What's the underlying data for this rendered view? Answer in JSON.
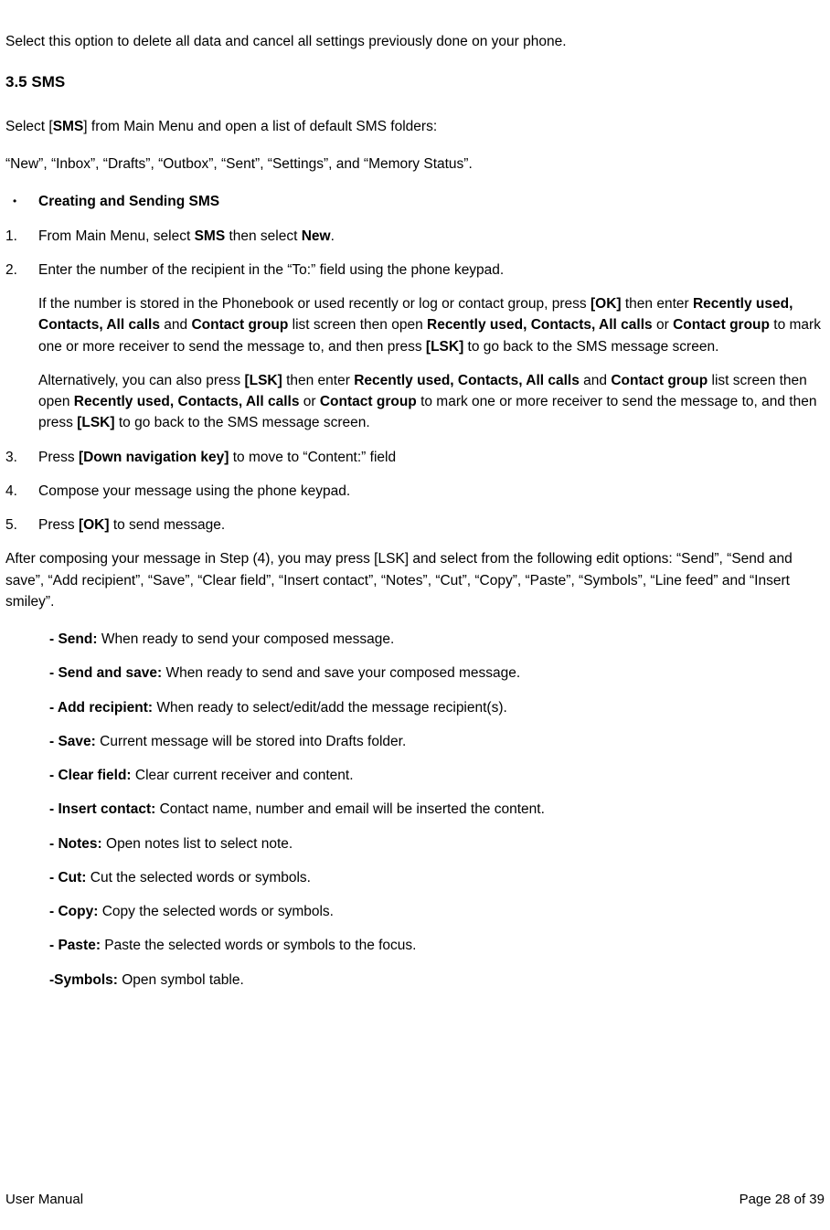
{
  "intro": "Select this option to delete all data and cancel all settings previously done on your phone.",
  "section_heading": "3.5 SMS",
  "p1_pre": "Select [",
  "p1_bold": "SMS",
  "p1_post": "] from Main Menu and open a list of default SMS folders:",
  "p2": "“New”, “Inbox”, “Drafts”, “Outbox”, “Sent”, “Settings”, and “Memory Status”.",
  "bullet_heading": "Creating and Sending SMS",
  "steps": {
    "s1": {
      "num": "1.",
      "t1": "From Main Menu, select ",
      "b1": "SMS",
      "t2": " then select ",
      "b2": "New",
      "t3": "."
    },
    "s2": {
      "num": "2.",
      "line1": "Enter the number of the recipient in the “To:” field using the phone keypad.",
      "p2_t1": "If the number is stored in the Phonebook or used recently or log or contact group, press ",
      "p2_b1": "[OK]",
      "p2_t2": " then enter ",
      "p2_b2": "Recently used, Contacts, All calls",
      "p2_t3": " and ",
      "p2_b3": "Contact group",
      "p2_t4": " list screen then open ",
      "p2_b4": "Recently used, Contacts, All calls",
      "p2_t5": " or ",
      "p2_b5": "Contact group",
      "p2_t6": " to mark one or more receiver to send the message to, and then press ",
      "p2_b6": "[LSK]",
      "p2_t7": " to go back to the SMS message screen.",
      "p3_t1": "Alternatively, you can also press ",
      "p3_b1": "[LSK]",
      "p3_t2": " then enter ",
      "p3_b2": "Recently used, Contacts, All calls",
      "p3_t3": " and ",
      "p3_b3": "Contact group",
      "p3_t4": " list screen then open ",
      "p3_b4": "Recently used, Contacts, All calls",
      "p3_t5": " or ",
      "p3_b5": "Contact group",
      "p3_t6": " to mark one or more receiver to send the message to, and then press ",
      "p3_b6": "[LSK]",
      "p3_t7": " to go back to the SMS message screen."
    },
    "s3": {
      "num": "3.",
      "t1": "Press ",
      "b1": "[Down navigation key]",
      "t2": " to move to “Content:” field"
    },
    "s4": {
      "num": "4.",
      "t1": "Compose your message using the phone keypad."
    },
    "s5": {
      "num": "5.",
      "t1": "Press ",
      "b1": "[OK]",
      "t2": " to send message."
    }
  },
  "after": "After composing your message in Step (4), you may press [LSK] and select from the following edit options: “Send”, “Send and save”, “Add recipient”, “Save”, “Clear field”, “Insert contact”, “Notes”, “Cut”, “Copy”, “Paste”, “Symbols”, “Line feed” and “Insert smiley”.",
  "opts": [
    {
      "b": "- Send:",
      "t": " When ready to send your composed message."
    },
    {
      "b": "- Send and save:",
      "t": " When ready to send and save your composed message."
    },
    {
      "b": "- Add recipient:",
      "t": " When ready to select/edit/add the message recipient(s)."
    },
    {
      "b": "- Save:",
      "t": " Current message will be stored into Drafts folder."
    },
    {
      "b": "- Clear field:",
      "t": " Clear current receiver and content."
    },
    {
      "b": "- Insert contact:",
      "t": " Contact name, number and email will be inserted the content."
    },
    {
      "b": "- Notes:",
      "t": " Open notes list to select note."
    },
    {
      "b": "- Cut:",
      "t": " Cut the selected words or symbols."
    },
    {
      "b": "- Copy:",
      "t": " Copy the selected words or symbols."
    },
    {
      "b": "- Paste:",
      "t": " Paste the selected words or symbols to the focus."
    },
    {
      "b": "-Symbols:",
      "t": " Open symbol table."
    }
  ],
  "footer": {
    "left": "User Manual",
    "right": "Page 28 of 39"
  }
}
